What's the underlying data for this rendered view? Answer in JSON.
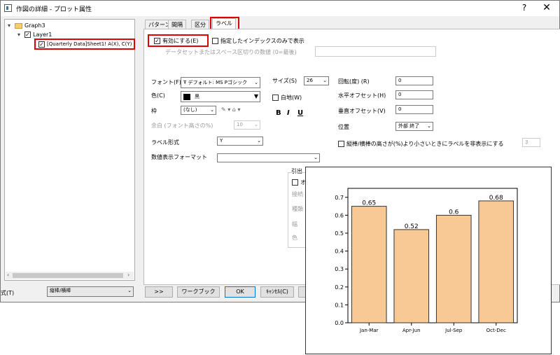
{
  "window": {
    "title": "作図の詳細 - プロット属性",
    "help": "?",
    "close": "✕"
  },
  "tree": {
    "graph": "Graph3",
    "layer": "Layer1",
    "plot": "[Quarterly Data]Sheet1! A(X), C(Y)"
  },
  "tabs": [
    "パターン",
    "間隔",
    "区分",
    "ラベル"
  ],
  "label_tab": {
    "enable": "有効にする(E)",
    "indexes_only": "指定したインデックスのみで表示",
    "dataset_hint": "データセットまたはスペース区切りの数値 (0=最後)",
    "font_label": "フォント(F)",
    "font_value": "デフォルト: MS Pゴシック",
    "color_label": "色(C)",
    "color_value": "黒",
    "frame_label": "枠",
    "frame_value": "(なし)",
    "margin_label": "余白 (フォント高さの%)",
    "margin_value": "10",
    "label_form_label": "ラベル形式",
    "label_form_value": "Y",
    "numeric_format_label": "数値表示フォーマット",
    "numeric_format_value": "",
    "size_label": "サイズ(S)",
    "size_value": "26",
    "white_bg": "白地(W)",
    "bold": "B",
    "italic": "I",
    "underline": "U",
    "rotation_label": "回転(度) (R)",
    "rotation_value": "0",
    "h_offset_label": "水平オフセット(H)",
    "h_offset_value": "0",
    "v_offset_label": "垂直オフセット(V)",
    "v_offset_value": "0",
    "position_label": "位置",
    "position_value": "外部 終了",
    "hide_small": "縦棒/横棒の高さが(%)より小さいときにラベルを非表示にする",
    "hide_small_value": "3",
    "leader_title": "引出",
    "leader_o": "オ",
    "leader_conn": "接続",
    "leader_type": "種類",
    "leader_width": "幅",
    "leader_color": "色"
  },
  "bottom": {
    "format_label": "式(T)",
    "format_value": "縦棒/横棒",
    "expand": ">>",
    "workbook": "ワークブック",
    "ok": "OK",
    "cancel": "ｷｬﾝｾﾙ(C)"
  },
  "chart_data": {
    "type": "bar",
    "categories": [
      "Jan-Mar",
      "Apr-Jun",
      "Jul-Sep",
      "Oct-Dec"
    ],
    "values": [
      0.65,
      0.52,
      0.6,
      0.68
    ],
    "data_labels": [
      "0.65",
      "0.52",
      "0.6",
      "0.68"
    ],
    "yticks": [
      "0.0",
      "0.1",
      "0.2",
      "0.3",
      "0.4",
      "0.5",
      "0.6",
      "0.7"
    ],
    "ylim": [
      0,
      0.75
    ],
    "bar_color": "#f8c995",
    "bar_edge": "#333333"
  }
}
